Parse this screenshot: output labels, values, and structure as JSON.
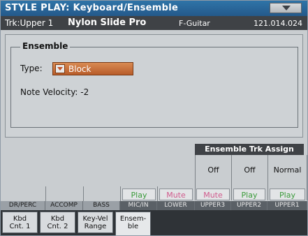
{
  "title": "STYLE PLAY: Keyboard/Ensemble",
  "track_bar": {
    "track": "Trk:Upper 1",
    "sound": "Nylon Slide Pro",
    "category": "F-Guitar",
    "program": "121.014.024"
  },
  "ensemble": {
    "section_label": "Ensemble",
    "type_label": "Type:",
    "type_value": "Block",
    "velocity_label": "Note Velocity:",
    "velocity_value": "-2"
  },
  "assign": {
    "header": "Ensemble Trk Assign",
    "values": [
      {
        "track": "UPPER3",
        "value": "Off"
      },
      {
        "track": "UPPER2",
        "value": "Off"
      },
      {
        "track": "UPPER1",
        "value": "Normal"
      }
    ]
  },
  "tracks": [
    {
      "label": "DR/PERC",
      "button": ""
    },
    {
      "label": "ACCOMP",
      "button": ""
    },
    {
      "label": "BASS",
      "button": ""
    },
    {
      "label": "MIC/IN",
      "button": "Play"
    },
    {
      "label": "LOWER",
      "button": "Mute"
    },
    {
      "label": "UPPER3",
      "button": "Mute"
    },
    {
      "label": "UPPER2",
      "button": "Play"
    },
    {
      "label": "UPPER1",
      "button": "Play"
    }
  ],
  "tabs": [
    {
      "line1": "Kbd",
      "line2": "Cnt. 1"
    },
    {
      "line1": "Kbd",
      "line2": "Cnt. 2"
    },
    {
      "line1": "Key-Vel",
      "line2": "Range"
    },
    {
      "line1": "Ensem-",
      "line2": "ble"
    }
  ],
  "colors": {
    "title_bg": "#24598a",
    "dropdown": "#c4662f",
    "play": "#3a9a3a",
    "mute": "#d05a8c"
  }
}
